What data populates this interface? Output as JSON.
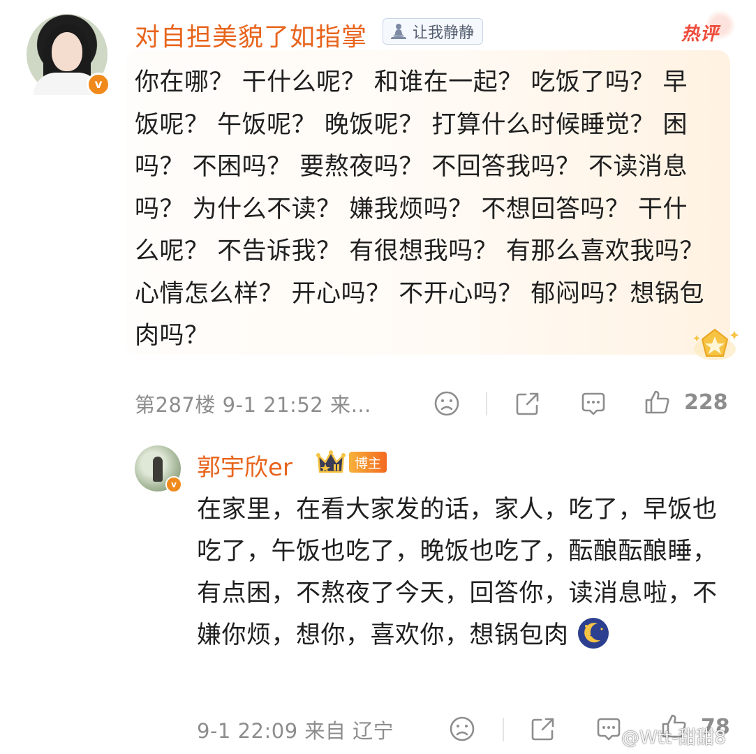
{
  "main_comment": {
    "username": "对自担美貌了如指掌",
    "tag": "让我静静",
    "hot_label": "热评",
    "text": "你在哪？ 干什么呢？ 和谁在一起？ 吃饭了吗？ 早饭呢？ 午饭呢？  晚饭呢？ 打算什么时候睡觉？  困吗？ 不困吗？  要熬夜吗？ 不回答我吗？  不读消息吗？ 为什么不读？  嫌我烦吗？ 不想回答吗？  干什么呢？ 不告诉我？  有很想我吗？  有那么喜欢我吗？  心情怎么样？  开心吗？  不开心吗？  郁闷吗？想锅包肉吗？",
    "meta": "第287楼 9-1 21:52 来…",
    "like_count": "228",
    "icons": {
      "verified": "v",
      "dislike": "frown-icon",
      "share": "share-icon",
      "reply": "comment-icon",
      "like": "thumb-up-icon"
    }
  },
  "reply": {
    "username": "郭宇欣er",
    "blogger_label": "博主",
    "text": "在家里，在看大家发的话，家人，吃了，早饭也吃了，午饭也吃了，晚饭也吃了，酝酿酝酿睡，有点困，不熬夜了今天，回答你，读消息啦，不嫌你烦，想你，喜欢你，想锅包肉",
    "meta": "9-1 22:09 来自 辽宁",
    "like_count": "78",
    "emoji": "moon-sleep-emoji"
  },
  "watermark": "@Wtt-甜甜8",
  "colors": {
    "username": "#e8641c",
    "hot": "#ee4b3a",
    "meta": "#8d8d8d",
    "verified": "#f08a1c"
  }
}
